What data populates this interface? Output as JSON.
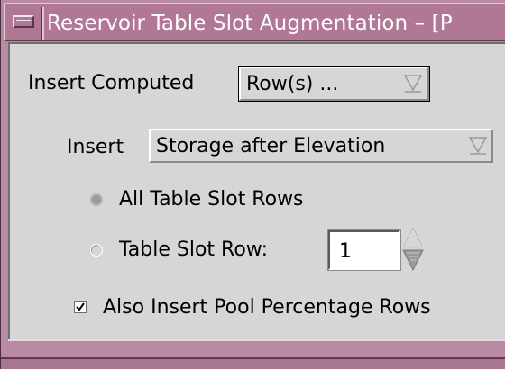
{
  "window": {
    "title": "Reservoir Table Slot Augmentation – [P"
  },
  "insert_computed": {
    "label": "Insert Computed",
    "selected": "Row(s) ..."
  },
  "insert": {
    "label": "Insert",
    "selected": "Storage after Elevation"
  },
  "rows_choice": {
    "all_label": "All Table Slot Rows",
    "all_selected": true,
    "single_label": "Table Slot Row:",
    "single_selected": false,
    "row_value": "1"
  },
  "pool_percentage": {
    "label": "Also Insert Pool Percentage Rows",
    "checked": true
  },
  "colors": {
    "titlebar": "#b17896",
    "frame": "#b98aa3",
    "panel": "#d6d6d6"
  }
}
